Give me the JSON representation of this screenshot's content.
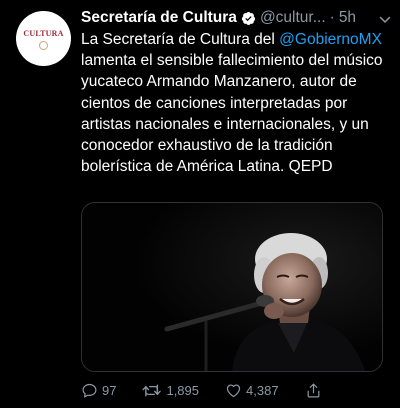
{
  "tweet": {
    "display_name": "Secretaría de Cultura",
    "handle": "@cultur...",
    "separator": "·",
    "time": "5h",
    "avatar_text": "CULTURA",
    "text_part1": "La Secretaría de Cultura del ",
    "mention": "@GobiernoMX",
    "text_part2": " lamenta el sensible fallecimiento del músico yucateco Armando Manzanero, autor de cientos de canciones interpretadas por artistas nacionales e internacionales, y un conocedor exhaustivo de la tradición bolerística de América Latina. QEPD",
    "replies": "97",
    "retweets": "1,895",
    "likes": "4,387"
  },
  "colors": {
    "background": "#000000",
    "text": "#ffffff",
    "secondary": "#8b98a5",
    "link": "#1da1f2"
  },
  "icons": {
    "verified": "verified-badge-icon",
    "more": "chevron-down-icon",
    "reply": "reply-icon",
    "retweet": "retweet-icon",
    "like": "heart-icon",
    "share": "share-icon"
  }
}
